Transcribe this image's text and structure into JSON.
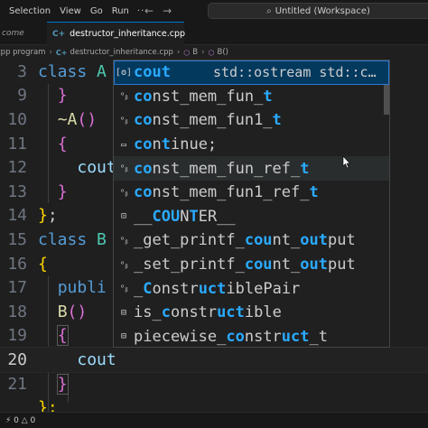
{
  "menubar": {
    "items": [
      "Selection",
      "View",
      "Go",
      "Run"
    ],
    "more": "···",
    "workspace_title": "Untitled (Workspace)"
  },
  "tabs": {
    "previous_tab_label": "come",
    "active_tab_label": "destructor_inheritance.cpp"
  },
  "breadcrumb": {
    "folder": "cpp program",
    "file": "destructor_inheritance.cpp",
    "class_symbol": "B",
    "method_symbol": "B()"
  },
  "editor": {
    "current_line": 20,
    "line_numbers": [
      "3",
      "9",
      "10",
      "11",
      "12",
      "13",
      "14",
      "15",
      "16",
      "17",
      "18",
      "19",
      "20",
      "21"
    ],
    "code": {
      "l3_kw": "class",
      "l3_cls": "A",
      "l9": "}",
      "l10_fn": "~A",
      "l10_paren": "()",
      "l11": "{",
      "l12": "cout",
      "l13": "}",
      "l14_brace": "}",
      "l14_semi": ";",
      "l15_kw": "class",
      "l15_cls": "B",
      "l16": "{",
      "l17": "publi",
      "l18_fn": "B",
      "l18_paren": "()",
      "l19": "{",
      "l20": "cout",
      "l21": "}",
      "l22": "};"
    }
  },
  "suggestions": [
    {
      "icon": "variable-icon",
      "glyph": "[ꙩ]",
      "pre": "",
      "hl": "cout",
      "post": "",
      "detail": "std::ostream std::c…"
    },
    {
      "icon": "class-icon",
      "glyph": "ᵒᵦ",
      "pre": "",
      "hl": "co",
      "post": "nst_mem_fun_",
      "hl2": "t",
      "post2": ""
    },
    {
      "icon": "class-icon",
      "glyph": "ᵒᵦ",
      "pre": "",
      "hl": "co",
      "post": "nst_mem_fun1_",
      "hl2": "t",
      "post2": ""
    },
    {
      "icon": "keyword-icon",
      "glyph": "▭",
      "pre": "",
      "hl": "co",
      "post": "n",
      "hl2": "t",
      "post2": "inue;"
    },
    {
      "icon": "class-icon",
      "glyph": "ᵒᵦ",
      "pre": "",
      "hl": "co",
      "post": "nst_mem_fun_ref_",
      "hl2": "t",
      "post2": ""
    },
    {
      "icon": "class-icon",
      "glyph": "ᵒᵦ",
      "pre": "",
      "hl": "co",
      "post": "nst_mem_fun1_ref_",
      "hl2": "t",
      "post2": ""
    },
    {
      "icon": "snippet-icon",
      "glyph": "⊡",
      "pre": "__",
      "hl": "COU",
      "post": "N",
      "hl2": "T",
      "post2": "ER__"
    },
    {
      "icon": "function-icon",
      "glyph": "ᵒᵦ",
      "pre": "_get_printf_",
      "hl": "cou",
      "post": "nt_",
      "hl2": "out",
      "post2": "put"
    },
    {
      "icon": "function-icon",
      "glyph": "ᵒᵦ",
      "pre": "_set_printf_",
      "hl": "cou",
      "post": "nt_",
      "hl2": "out",
      "post2": "put"
    },
    {
      "icon": "class-icon",
      "glyph": "ᵒᵦ",
      "pre": "_",
      "hl": "C",
      "post": "onstr",
      "hl2": "uct",
      "post2": "iblePair"
    },
    {
      "icon": "struct-icon",
      "glyph": "⊟",
      "pre": "is_",
      "hl": "c",
      "post": "onstr",
      "hl2": "uct",
      "post2": "ible"
    },
    {
      "icon": "struct-icon",
      "glyph": "⊟",
      "pre": "piecewise_",
      "hl": "co",
      "post": "nstr",
      "hl2": "uct",
      "post2": "_t"
    }
  ],
  "statusbar": {
    "left": "⚡ 0 △ 0"
  }
}
